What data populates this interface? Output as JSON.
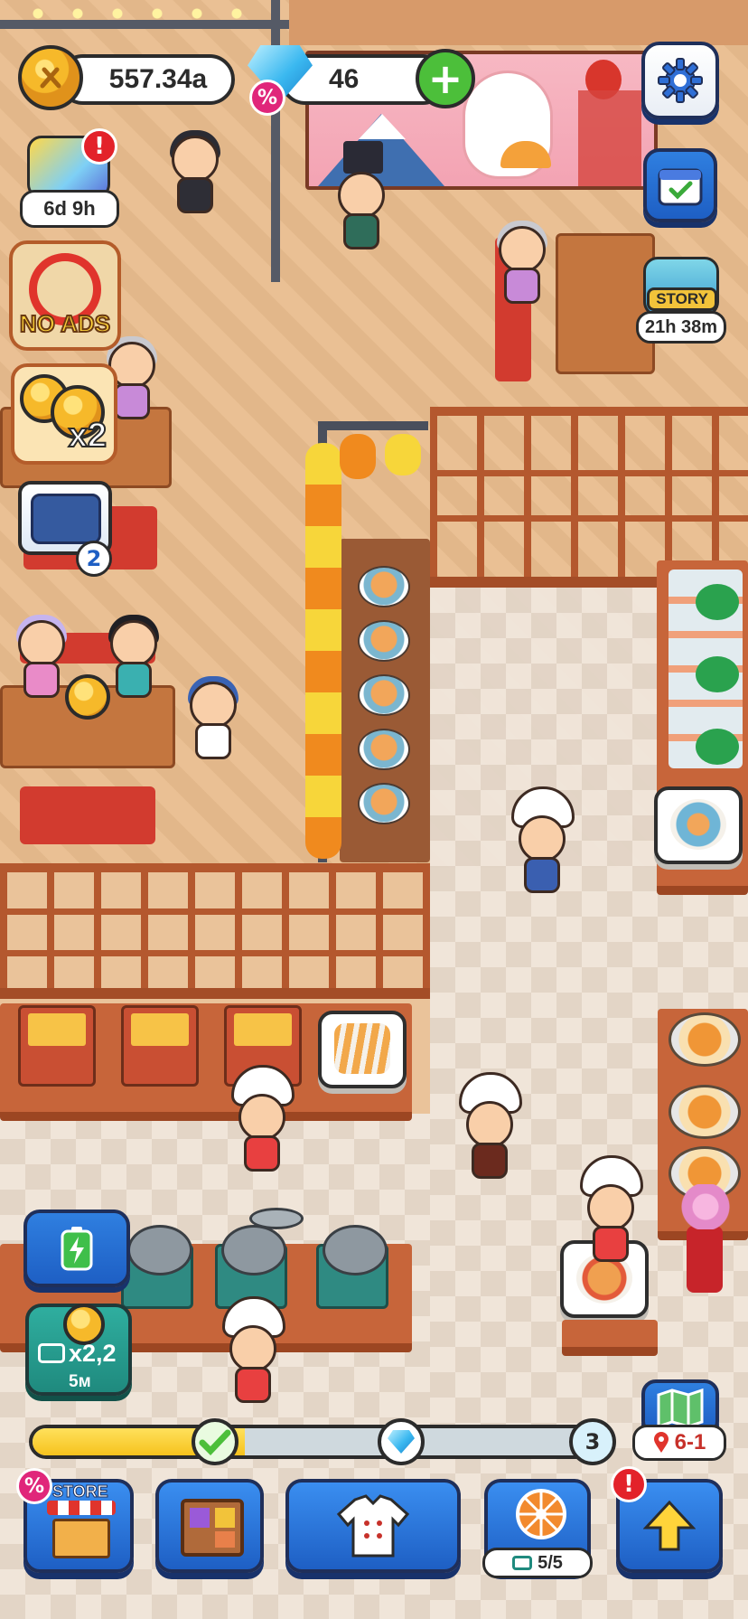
{
  "hud": {
    "coins": "557.34a",
    "gems": "46",
    "sale_symbol": "%",
    "plus": "+"
  },
  "side": {
    "event_timer": "6d 9h",
    "alert": "!",
    "no_ads": "NO ADS",
    "coins_multiplier": "x2",
    "chest_count": "2",
    "story_label": "STORY",
    "story_timer": "21h 38m",
    "boost_multiplier": "x2,2",
    "boost_duration": "5м"
  },
  "progress": {
    "fraction": 0.37,
    "end_milestone": "3"
  },
  "map": {
    "level": "6-1"
  },
  "bottom": {
    "store_label": "STORE",
    "wheel_count": "5/5",
    "alert": "!"
  },
  "colors": {
    "accent_blue": "#1e5fc4",
    "gold": "#f6c21d",
    "alert_red": "#e3222a",
    "sale_pink": "#e0267a",
    "go_green": "#4cbf3a"
  },
  "icons": {
    "coin": "coin-spoon-fork-icon",
    "gem": "diamond-icon",
    "settings": "gear-icon",
    "calendar": "calendar-check-icon",
    "battery": "battery-bolt-icon",
    "map": "map-icon",
    "pin": "location-pin-icon",
    "wheel": "lucky-wheel-icon",
    "upgrade": "up-arrow-icon",
    "chef": "chef-jacket-icon",
    "store": "store-stall-icon",
    "decor": "cabinet-icon",
    "video": "video-ad-icon"
  }
}
